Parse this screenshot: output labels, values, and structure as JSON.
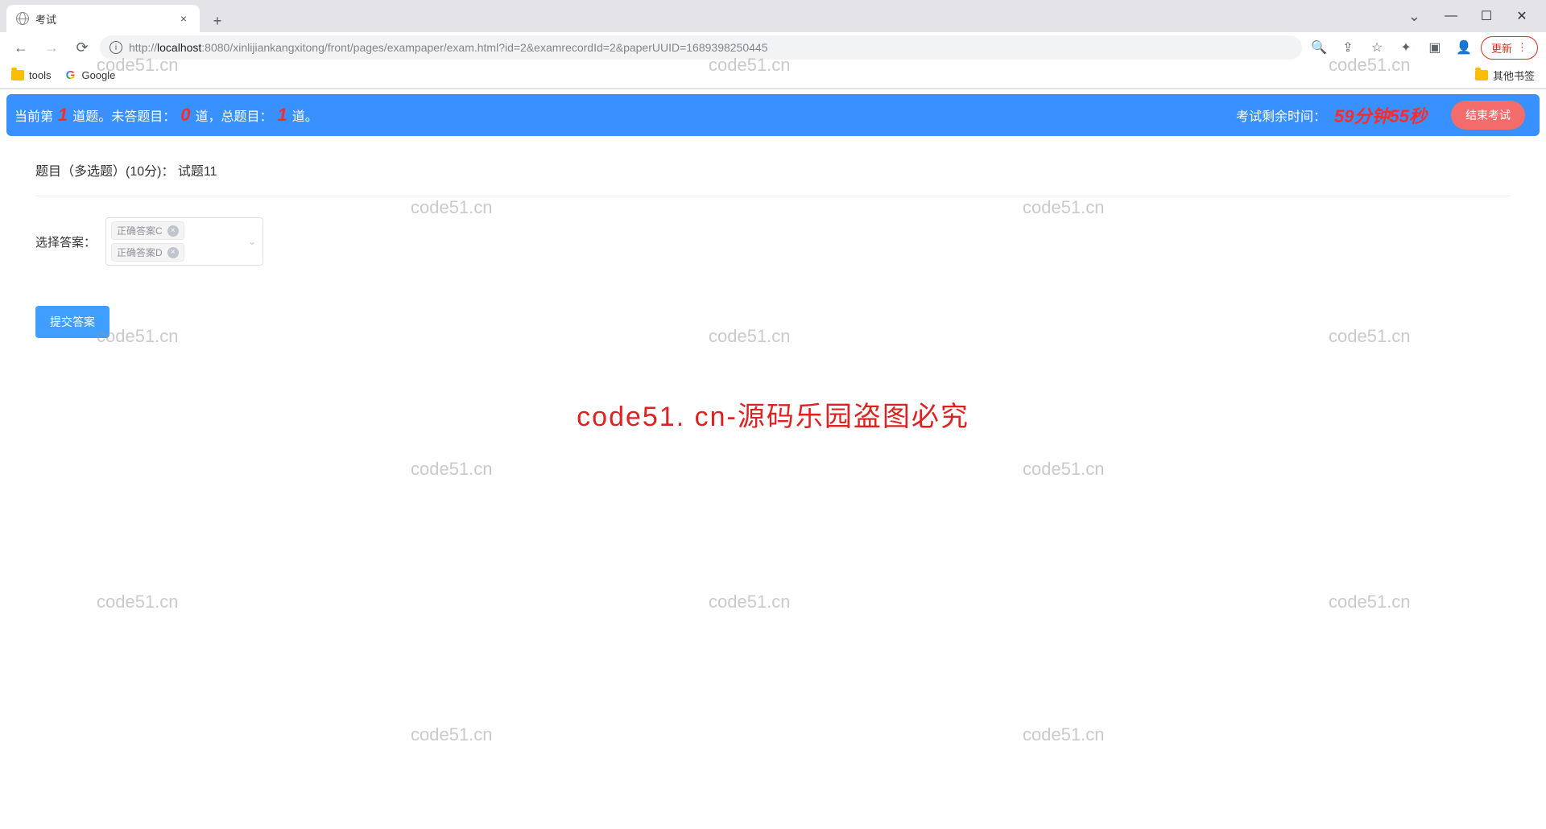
{
  "browser": {
    "tab_title": "考试",
    "url_full": "http://localhost:8080/xinlijiankangxitong/front/pages/exampaper/exam.html?id=2&examrecordId=2&paperUUID=1689398250445",
    "url_host": "localhost",
    "url_port": ":8080",
    "url_scheme": "http://",
    "url_path": "/xinlijiankangxitong/front/pages/exampaper/exam.html?id=2&examrecordId=2&paperUUID=1689398250445",
    "update_label": "更新",
    "bookmarks": {
      "tools": "tools",
      "google": "Google",
      "other": "其他书签"
    }
  },
  "exam": {
    "status_prefix": "当前第",
    "current_num": "1",
    "status_mid1": "道题。未答题目：",
    "unanswered_num": "0",
    "status_mid2": "道，总题目：",
    "total_num": "1",
    "status_suffix": "道。",
    "timer_label": "考试剩余时间：",
    "timer_value": "59分钟55秒",
    "end_button": "结束考试",
    "question_title": "题目（多选题）(10分)： 试题11",
    "answer_label": "选择答案：",
    "selected_tags": [
      "正确答案C",
      "正确答案D"
    ],
    "submit_button": "提交答案"
  },
  "watermark": {
    "small": "code51.cn",
    "big": "code51. cn-源码乐园盗图必究"
  }
}
